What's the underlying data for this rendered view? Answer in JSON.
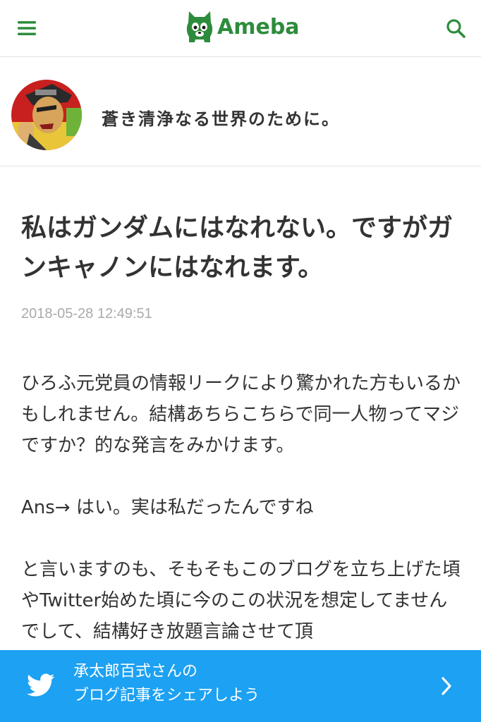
{
  "header": {
    "logo_text": "Ameba",
    "menu_icon": "hamburger-menu-icon",
    "search_icon": "search-icon",
    "brand_color": "#2d8c3c"
  },
  "profile": {
    "blog_title": "蒼き清浄なる世界のために。",
    "avatar": "avatar-image"
  },
  "article": {
    "title": "私はガンダムにはなれない。ですがガンキャノンにはなれます。",
    "date": "2018-05-28 12:49:51",
    "paragraphs": [
      "ひろふ元党員の情報リークにより驚かれた方もいるかもしれません。結構あちらこちらで同一人物ってマジですか？的な発言をみかけます。",
      "Ans→ はい。実は私だったんですね",
      "と言いますのも、そもそもこのブログを立ち上げた頃やTwitter始めた頃に今のこの状況を想定してませんでして、結構好き放題言論させて頂"
    ]
  },
  "share": {
    "line1": "承太郎百式さんの",
    "line2": "ブログ記事をシェアしよう",
    "icon": "twitter-icon",
    "color": "#1da1f2"
  }
}
